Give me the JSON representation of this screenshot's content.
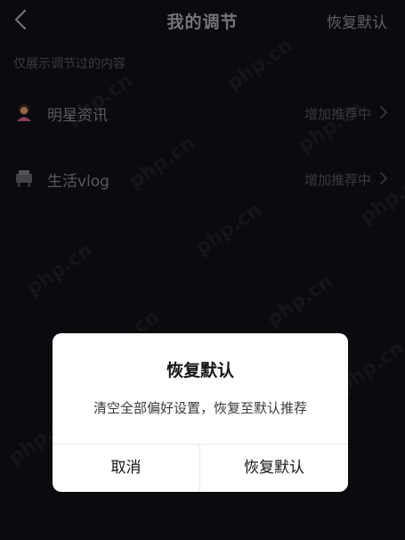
{
  "header": {
    "back_icon": "chevron-left-icon",
    "title": "我的调节",
    "reset_label": "恢复默认"
  },
  "hint": "仅展示调节过的内容",
  "rows": [
    {
      "icon": "celebrity-icon",
      "label": "明星资讯",
      "action": "增加推荐中"
    },
    {
      "icon": "life-vlog-icon",
      "label": "生活vlog",
      "action": "增加推荐中"
    }
  ],
  "dialog": {
    "title": "恢复默认",
    "message": "清空全部偏好设置，恢复至默认推荐",
    "cancel_label": "取消",
    "confirm_label": "恢复默认"
  },
  "watermark": "php.cn",
  "colors": {
    "background": "#0f0f14",
    "dialog_background": "#ffffff",
    "primary_text": "#161616",
    "muted_text": "#75757c"
  }
}
